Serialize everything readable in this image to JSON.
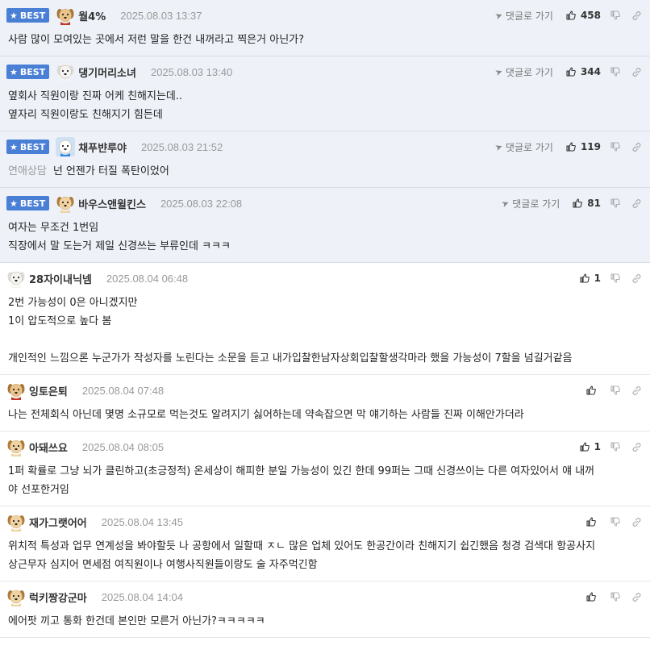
{
  "comments": [
    {
      "best": true,
      "badge": "BEST",
      "nick": "월4%",
      "date": "2025.08.03 13:37",
      "goto": "댓글로 가기",
      "likes": "458",
      "avatar": "dog-red",
      "tag": "",
      "lines": [
        "사람 많이 모여있는 곳에서 저런 말을 한건 내꺼라고 찍은거 아닌가?"
      ]
    },
    {
      "best": true,
      "badge": "BEST",
      "nick": "댕기머리소녀",
      "date": "2025.08.03 13:40",
      "goto": "댓글로 가기",
      "likes": "344",
      "avatar": "dog-white",
      "tag": "",
      "lines": [
        "옆회사 직원이랑 진짜 어케 친해지는데..",
        "옆자리 직원이랑도 친해지기 힘든데"
      ]
    },
    {
      "best": true,
      "badge": "BEST",
      "nick": "채푸뱐루야",
      "date": "2025.08.03 21:52",
      "goto": "댓글로 가기",
      "likes": "119",
      "avatar": "dog-blue",
      "tag": "연애상담",
      "lines": [
        "넌 언젠가 터질 폭탄이었어"
      ]
    },
    {
      "best": true,
      "badge": "BEST",
      "nick": "바우스앤윌킨스",
      "date": "2025.08.03 22:08",
      "goto": "댓글로 가기",
      "likes": "81",
      "avatar": "dog-tan",
      "tag": "",
      "lines": [
        "여자는 무조건 1번임",
        "직장에서 말 도는거 제일 신경쓰는 부류인데 ㅋㅋㅋ"
      ]
    },
    {
      "best": false,
      "nick": "28자이내닉넴",
      "date": "2025.08.04 06:48",
      "likes": "1",
      "avatar": "dog-white",
      "tag": "",
      "lines": [
        "2번 가능성이 0은 아니겠지만",
        "1이 압도적으로 높다 봄",
        "",
        "개인적인 느낌으론 누군가가 작성자를 노린다는 소문을 듣고 내가입찰한남자상회입찰할생각마라 했을 가능성이 7할을 넘길거같음"
      ]
    },
    {
      "best": false,
      "nick": "잉토은퇴",
      "date": "2025.08.04 07:48",
      "likes": "",
      "avatar": "dog-red",
      "tag": "",
      "lines": [
        "나는 전체회식 아닌데 몇명 소규모로 먹는것도 알려지기 싫어하는데 약속잡으면 막 얘기하는 사람들 진짜 이해안가더라"
      ]
    },
    {
      "best": false,
      "nick": "아돼쓰요",
      "date": "2025.08.04 08:05",
      "likes": "1",
      "avatar": "dog-tan",
      "tag": "",
      "lines": [
        "1퍼 확률로 그냥 뇌가 클린하고(초긍정적) 온세상이 해피한 분일 가능성이 있긴 한데 99퍼는 그때 신경쓰이는 다른 여자있어서 얘 내꺼",
        "야 선포한거임"
      ]
    },
    {
      "best": false,
      "nick": "재가그랫어어",
      "date": "2025.08.04 13:45",
      "likes": "",
      "avatar": "dog-tan",
      "tag": "",
      "lines": [
        "위치적 특성과 업무 연계성을 봐야할듯 나 공항에서 일할때 ㅈㄴ 많은 업체 있어도 한공간이라 친해지기 쉽긴했음 청경 검색대 항공사지",
        "상근무자 심지어 면세점 여직원이나 여행사직원들이랑도 술 자주먹긴함"
      ]
    },
    {
      "best": false,
      "nick": "럭키짱강군마",
      "date": "2025.08.04 14:04",
      "likes": "",
      "avatar": "dog-tan",
      "tag": "",
      "lines": [
        "에어팟 끼고 통화 한건데 본인만 모른거 아닌가?ㅋㅋㅋㅋㅋ"
      ]
    }
  ]
}
